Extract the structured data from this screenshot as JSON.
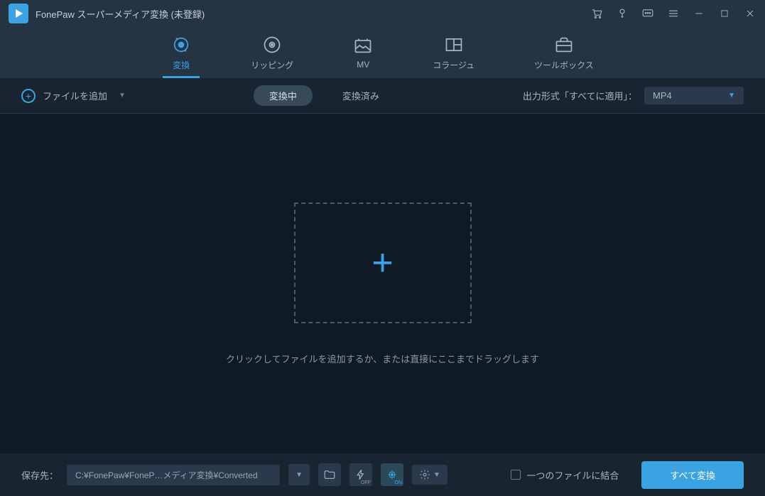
{
  "app": {
    "title": "FonePaw スーパーメディア変換 (未登録)"
  },
  "tabs": {
    "convert": "変換",
    "ripping": "リッピング",
    "mv": "MV",
    "collage": "コラージュ",
    "toolbox": "ツールボックス"
  },
  "subtoolbar": {
    "add_file": "ファイルを追加",
    "converting": "変換中",
    "converted": "変換済み",
    "output_label": "出力形式「すべてに適用」：",
    "output_format": "MP4"
  },
  "dropzone": {
    "hint": "クリックしてファイルを追加するか、または直接にここまでドラッグします"
  },
  "bottom": {
    "save_label": "保存先：",
    "path": "C:¥FonePaw¥FoneP…メディア変換¥Converted",
    "gpu_off_badge": "OFF",
    "gpu_on_badge": "ON",
    "merge_label": "一つのファイルに結合",
    "convert_all": "すべて変換"
  }
}
